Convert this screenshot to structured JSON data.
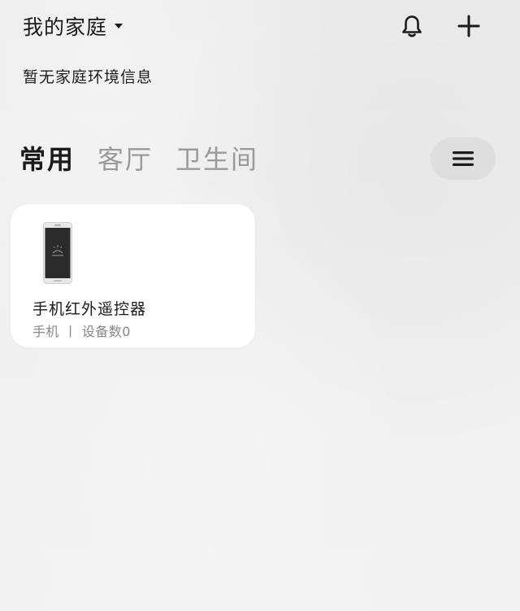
{
  "header": {
    "home_title": "我的家庭",
    "icons": {
      "dropdown": "caret-down-icon",
      "notifications": "bell-icon",
      "add": "plus-icon"
    }
  },
  "environment": {
    "message": "暂无家庭环境信息"
  },
  "tabs": [
    {
      "label": "常用",
      "active": true
    },
    {
      "label": "客厅",
      "active": false
    },
    {
      "label": "卫生间",
      "active": false
    }
  ],
  "menu_button": {
    "icon": "hamburger-menu-icon"
  },
  "devices": [
    {
      "name": "手机红外遥控器",
      "type": "手机",
      "separator": "丨",
      "count_label": "设备数0",
      "icon": "phone-icon"
    }
  ],
  "colors": {
    "background": "#eeeeee",
    "card": "#ffffff",
    "text_primary": "#1a1a1a",
    "text_inactive": "#9a9a9a",
    "text_secondary": "#888888",
    "menu_button_bg": "#dedede"
  }
}
